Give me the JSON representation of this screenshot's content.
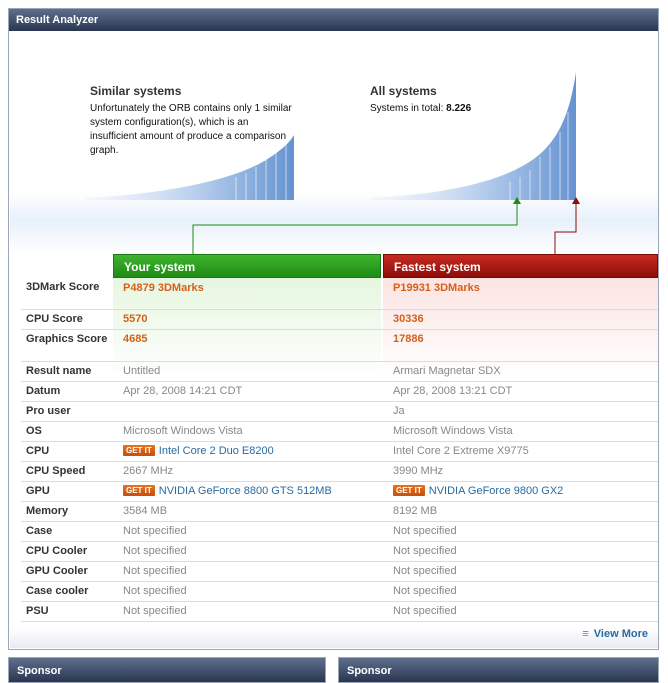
{
  "panel_title": "Result Analyzer",
  "similar": {
    "title": "Similar systems",
    "text": "Unfortunately the ORB contains only 1 similar system configuration(s), which is an insufficient amount of produce a comparison graph."
  },
  "all": {
    "title": "All systems",
    "total_label": "Systems in total:",
    "total_value": "8.226"
  },
  "columns": {
    "your": "Your system",
    "fastest": "Fastest system"
  },
  "rows": [
    {
      "label": "3DMark Score",
      "your": "P4879 3DMarks",
      "fast": "P19931 3DMarks"
    },
    {
      "label": "CPU Score",
      "your": "5570",
      "fast": "30336"
    },
    {
      "label": "Graphics Score",
      "your": "4685",
      "fast": "17886"
    },
    {
      "label": "Result name",
      "your": "Untitled",
      "fast": "Armari Magnetar SDX"
    },
    {
      "label": "Datum",
      "your": "Apr 28, 2008 14:21 CDT",
      "fast": "Apr 28, 2008 13:21 CDT"
    },
    {
      "label": "Pro user",
      "your": "",
      "fast": "Ja"
    },
    {
      "label": "OS",
      "your": "Microsoft Windows Vista",
      "fast": "Microsoft Windows Vista"
    },
    {
      "label": "CPU",
      "your": "Intel Core 2 Duo E8200",
      "fast": "Intel Core 2 Extreme X9775"
    },
    {
      "label": "CPU Speed",
      "your": "2667 MHz",
      "fast": "3990 MHz"
    },
    {
      "label": "GPU",
      "your": "NVIDIA GeForce 8800 GTS 512MB",
      "fast": "NVIDIA GeForce 9800 GX2"
    },
    {
      "label": "Memory",
      "your": "3584 MB",
      "fast": "8192 MB"
    },
    {
      "label": "Case",
      "your": "Not specified",
      "fast": "Not specified"
    },
    {
      "label": "CPU Cooler",
      "your": "Not specified",
      "fast": "Not specified"
    },
    {
      "label": "GPU Cooler",
      "your": "Not specified",
      "fast": "Not specified"
    },
    {
      "label": "Case cooler",
      "your": "Not specified",
      "fast": "Not specified"
    },
    {
      "label": "PSU",
      "your": "Not specified",
      "fast": "Not specified"
    }
  ],
  "getit_label": "GET IT",
  "view_more": "View More",
  "sponsor_left": "Sponsor",
  "sponsor_right": "Sponsor",
  "colors": {
    "header": "#2a3650",
    "your_green": "#1f8a15",
    "fast_red": "#8c0d08",
    "score_orange": "#d4601a",
    "link_blue": "#2a6aa0",
    "graph_blue": "#5b8fd0"
  }
}
